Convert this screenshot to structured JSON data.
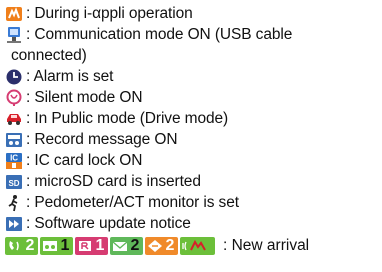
{
  "items": [
    {
      "icon": "iappli-icon",
      "text": ": During i-αppli operation"
    },
    {
      "icon": "usb-communication-icon",
      "text": ": Communication mode ON (USB cable"
    },
    {
      "icon": "",
      "text": "connected)"
    },
    {
      "icon": "alarm-icon",
      "text": ": Alarm is set"
    },
    {
      "icon": "silent-mode-icon",
      "text": ": Silent mode ON"
    },
    {
      "icon": "public-mode-car-icon",
      "text": ": In Public mode (Drive mode)"
    },
    {
      "icon": "record-message-icon",
      "text": ": Record message ON"
    },
    {
      "icon": "ic-card-lock-icon",
      "text": ": IC card lock ON"
    },
    {
      "icon": "microsd-icon",
      "text": ": microSD card is inserted"
    },
    {
      "icon": "pedometer-icon",
      "text": ": Pedometer/ACT monitor is set"
    },
    {
      "icon": "software-update-icon",
      "text": ": Software update notice"
    }
  ],
  "new_arrival": {
    "label": ": New arrival",
    "segments": [
      {
        "icon": "missed-call-icon",
        "count": "2",
        "color": "#6cbf3a"
      },
      {
        "icon": "voice-message-icon",
        "count": "1",
        "color": "#6cbf3a"
      },
      {
        "icon": "message-r-icon",
        "count": "1",
        "color": "#d63c72"
      },
      {
        "icon": "mail-icon",
        "count": "2",
        "color": "#5fb85a"
      },
      {
        "icon": "chat-icon",
        "count": "2",
        "color": "#f08a2a"
      },
      {
        "icon": "iconcier-icon",
        "count": "",
        "color": "#6cbf3a"
      }
    ]
  }
}
